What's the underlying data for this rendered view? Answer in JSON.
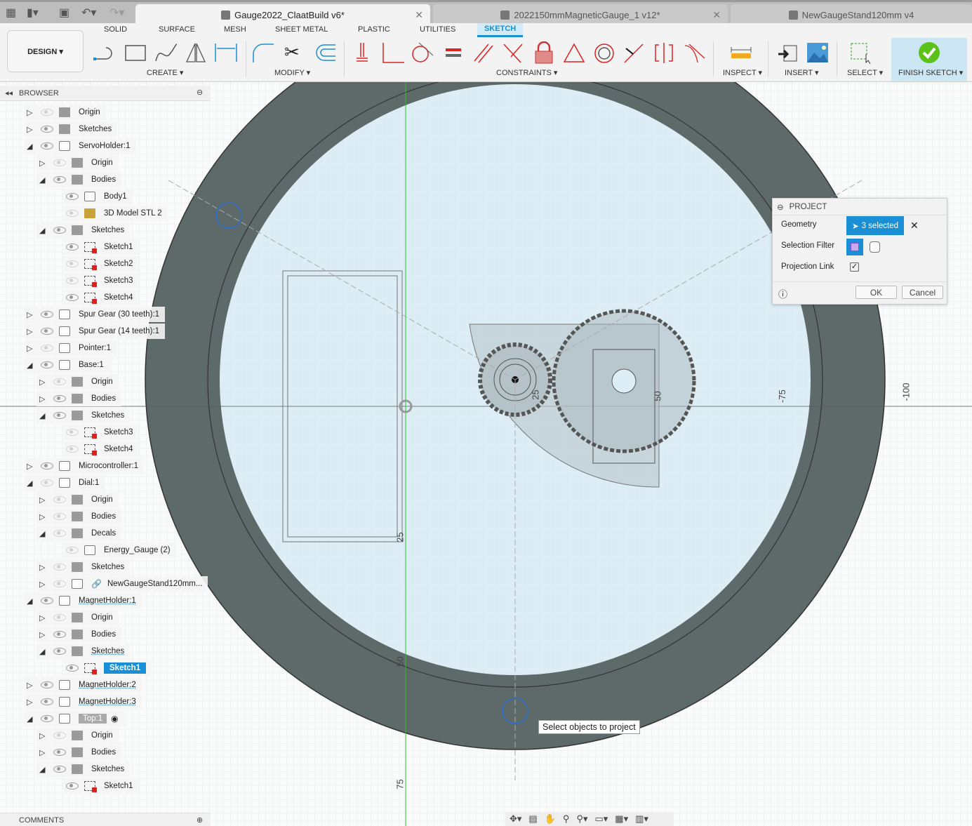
{
  "tabs": [
    {
      "title": "Gauge2022_ClaatBuild v6*",
      "active": true
    },
    {
      "title": "2022150mmMagneticGauge_1 v12*",
      "active": false
    },
    {
      "title": "NewGaugeStand120mm v4",
      "active": false
    }
  ],
  "ribbon": {
    "workspace": "DESIGN ▾",
    "tabs": [
      "SOLID",
      "SURFACE",
      "MESH",
      "SHEET METAL",
      "PLASTIC",
      "UTILITIES",
      "SKETCH"
    ],
    "active_tab": "SKETCH",
    "groups": [
      "CREATE ▾",
      "MODIFY ▾",
      "CONSTRAINTS ▾",
      "INSPECT ▾",
      "INSERT ▾",
      "SELECT ▾",
      "FINISH SKETCH ▾"
    ],
    "accent": "#1a8fd6"
  },
  "browser": {
    "title": "BROWSER",
    "items": [
      {
        "label": "Origin",
        "level": 0,
        "state": "collapsed",
        "icon": "folder",
        "visible": false
      },
      {
        "label": "Sketches",
        "level": 0,
        "state": "collapsed",
        "icon": "folder",
        "visible": true
      },
      {
        "label": "ServoHolder:1",
        "level": 0,
        "state": "expanded",
        "icon": "component",
        "visible": true
      },
      {
        "label": "Origin",
        "level": 1,
        "state": "collapsed",
        "icon": "folder",
        "visible": false
      },
      {
        "label": "Bodies",
        "level": 1,
        "state": "expanded",
        "icon": "folder",
        "visible": true
      },
      {
        "label": "Body1",
        "level": 2,
        "icon": "body",
        "visible": true
      },
      {
        "label": "3D Model STL 2",
        "level": 2,
        "icon": "mesh",
        "visible": false
      },
      {
        "label": "Sketches",
        "level": 1,
        "state": "expanded",
        "icon": "folder",
        "visible": true
      },
      {
        "label": "Sketch1",
        "level": 2,
        "icon": "sketch",
        "visible": true
      },
      {
        "label": "Sketch2",
        "level": 2,
        "icon": "sketch",
        "visible": false
      },
      {
        "label": "Sketch3",
        "level": 2,
        "icon": "sketch",
        "visible": false
      },
      {
        "label": "Sketch4",
        "level": 2,
        "icon": "sketch",
        "visible": true
      },
      {
        "label": "Spur Gear (30 teeth):1",
        "level": 0,
        "state": "collapsed",
        "icon": "component",
        "visible": true
      },
      {
        "label": "Spur Gear (14 teeth):1",
        "level": 0,
        "state": "collapsed",
        "icon": "component",
        "visible": true
      },
      {
        "label": "Pointer:1",
        "level": 0,
        "state": "collapsed",
        "icon": "component",
        "visible": false
      },
      {
        "label": "Base:1",
        "level": 0,
        "state": "expanded",
        "icon": "component",
        "visible": true
      },
      {
        "label": "Origin",
        "level": 1,
        "state": "collapsed",
        "icon": "folder",
        "visible": false
      },
      {
        "label": "Bodies",
        "level": 1,
        "state": "collapsed",
        "icon": "folder",
        "visible": true
      },
      {
        "label": "Sketches",
        "level": 1,
        "state": "expanded",
        "icon": "folder",
        "visible": true
      },
      {
        "label": "Sketch3",
        "level": 2,
        "icon": "sketch",
        "visible": false
      },
      {
        "label": "Sketch4",
        "level": 2,
        "icon": "sketch",
        "visible": false
      },
      {
        "label": "Microcontroller:1",
        "level": 0,
        "state": "collapsed",
        "icon": "component",
        "visible": true
      },
      {
        "label": "Dial:1",
        "level": 0,
        "state": "expanded",
        "icon": "component",
        "visible": false
      },
      {
        "label": "Origin",
        "level": 1,
        "state": "collapsed",
        "icon": "folder",
        "visible": false
      },
      {
        "label": "Bodies",
        "level": 1,
        "state": "collapsed",
        "icon": "folder",
        "visible": false
      },
      {
        "label": "Decals",
        "level": 1,
        "state": "expanded",
        "icon": "folder",
        "visible": false
      },
      {
        "label": "Energy_Gauge (2)",
        "level": 2,
        "icon": "decal",
        "visible": false
      },
      {
        "label": "Sketches",
        "level": 1,
        "state": "collapsed",
        "icon": "folder",
        "visible": false
      },
      {
        "label": "NewGaugeStand120mm...",
        "level": 1,
        "state": "collapsed",
        "icon": "link",
        "visible": false
      },
      {
        "label": "MagnetHolder:1",
        "level": 0,
        "state": "expanded",
        "icon": "component",
        "visible": true,
        "wavy": true
      },
      {
        "label": "Origin",
        "level": 1,
        "state": "collapsed",
        "icon": "folder",
        "visible": false
      },
      {
        "label": "Bodies",
        "level": 1,
        "state": "collapsed",
        "icon": "folder",
        "visible": true
      },
      {
        "label": "Sketches",
        "level": 1,
        "state": "expanded",
        "icon": "folder",
        "visible": true,
        "wavy": true
      },
      {
        "label": "Sketch1",
        "level": 2,
        "icon": "sketch",
        "visible": true,
        "selected": true
      },
      {
        "label": "MagnetHolder:2",
        "level": 0,
        "state": "collapsed",
        "icon": "component",
        "visible": true,
        "wavy": true
      },
      {
        "label": "MagnetHolder:3",
        "level": 0,
        "state": "collapsed",
        "icon": "component",
        "visible": true,
        "wavy": true
      },
      {
        "label": "Top:1",
        "level": 0,
        "state": "expanded",
        "icon": "component",
        "visible": true,
        "active": true
      },
      {
        "label": "Origin",
        "level": 1,
        "state": "collapsed",
        "icon": "folder",
        "visible": false
      },
      {
        "label": "Bodies",
        "level": 1,
        "state": "collapsed",
        "icon": "folder",
        "visible": true
      },
      {
        "label": "Sketches",
        "level": 1,
        "state": "expanded",
        "icon": "folder",
        "visible": true
      },
      {
        "label": "Sketch1",
        "level": 2,
        "icon": "sketch",
        "visible": true
      }
    ]
  },
  "project_dialog": {
    "title": "PROJECT",
    "geometry_label": "Geometry",
    "geometry_value": "3 selected",
    "filter_label": "Selection Filter",
    "link_label": "Projection Link",
    "link_checked": true,
    "ok": "OK",
    "cancel": "Cancel"
  },
  "tooltip": "Select objects to project",
  "dimensions": [
    "25",
    "50",
    "25",
    "-75",
    "-100",
    "50",
    "75"
  ],
  "comments": "COMMENTS"
}
